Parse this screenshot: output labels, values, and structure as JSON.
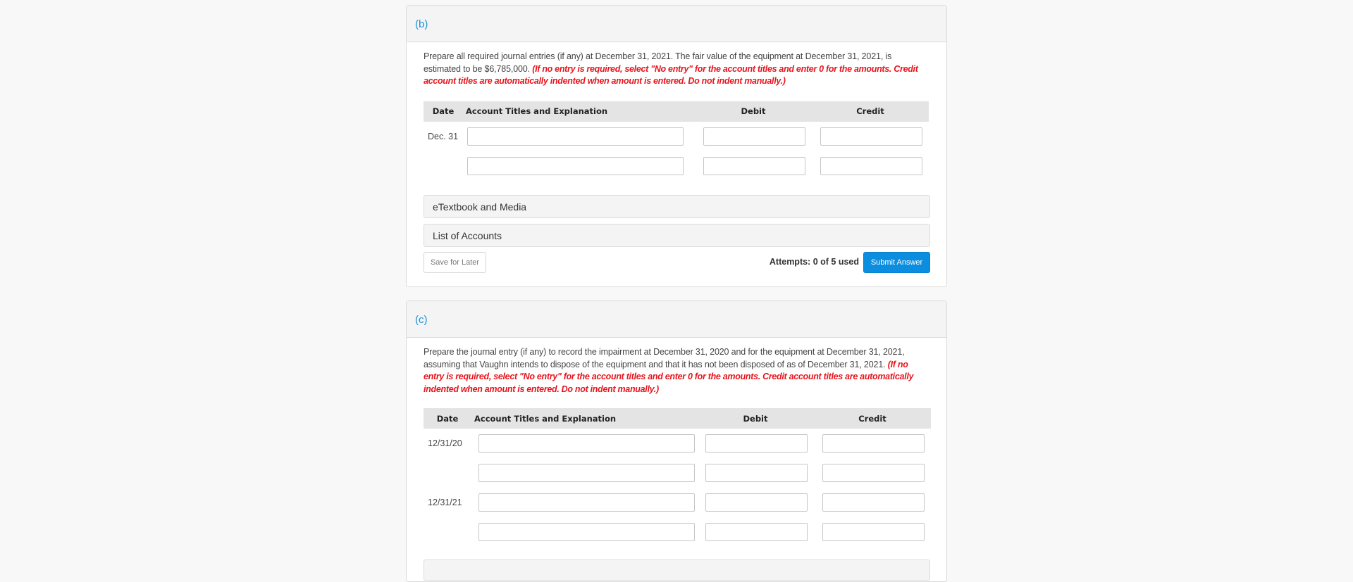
{
  "parts": [
    {
      "label": "(b)",
      "question_text": "Prepare all required journal entries (if any) at December 31, 2021. The fair value of the equipment at December 31, 2021, is estimated to be $6,785,000.",
      "instruction": "(If no entry is required, select \"No entry\" for the account titles and enter 0 for the amounts. Credit account titles are automatically indented when amount is entered. Do not indent manually.)",
      "table": {
        "headers": {
          "date": "Date",
          "account": "Account Titles and Explanation",
          "debit": "Debit",
          "credit": "Credit"
        },
        "rows": [
          {
            "date": "Dec. 31",
            "account": "",
            "debit": "",
            "credit": ""
          },
          {
            "date": "",
            "account": "",
            "debit": "",
            "credit": ""
          }
        ]
      },
      "accordions": [
        "eTextbook and Media",
        "List of Accounts"
      ],
      "save_label": "Save for Later",
      "attempts_text": "Attempts: 0 of 5 used",
      "submit_label": "Submit Answer"
    },
    {
      "label": "(c)",
      "question_text": "Prepare the journal entry (if any) to record the impairment at December 31, 2020 and for the equipment at December 31, 2021, assuming that Vaughn intends to dispose of the equipment and that it has not been disposed of as of December 31, 2021.",
      "instruction": "(If no entry is required, select \"No entry\" for the account titles and enter 0 for the amounts. Credit account titles are automatically indented when amount is entered. Do not indent manually.)",
      "table": {
        "headers": {
          "date": "Date",
          "account": "Account Titles and Explanation",
          "debit": "Debit",
          "credit": "Credit"
        },
        "rows": [
          {
            "date": "12/31/20",
            "account": "",
            "debit": "",
            "credit": ""
          },
          {
            "date": "",
            "account": "",
            "debit": "",
            "credit": ""
          },
          {
            "date": "12/31/21",
            "account": "",
            "debit": "",
            "credit": ""
          },
          {
            "date": "",
            "account": "",
            "debit": "",
            "credit": ""
          }
        ]
      }
    }
  ],
  "colors": {
    "part_label": "#1a8fd6",
    "instruction_red": "#e8141c",
    "submit_button": "#0c8ee0"
  }
}
